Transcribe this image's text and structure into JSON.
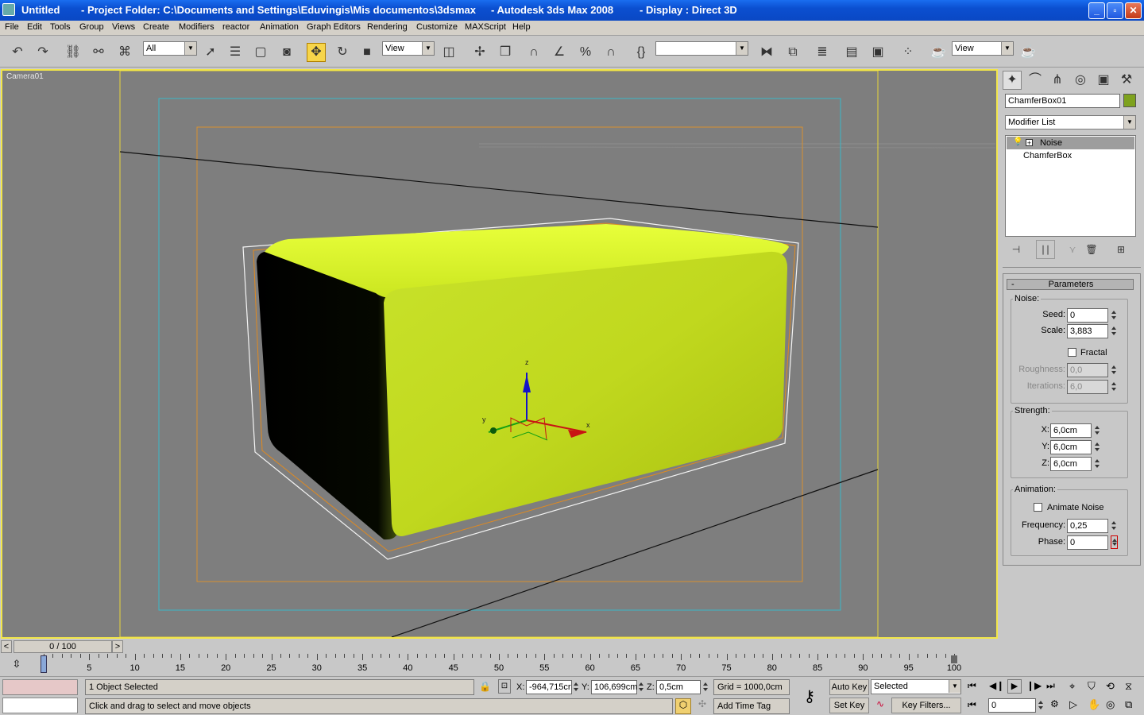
{
  "titlebar": {
    "file": "Untitled",
    "project": "- Project Folder: C:\\Documents and Settings\\Eduvingis\\Mis documentos\\3dsmax",
    "app": "- Autodesk 3ds Max 2008",
    "display": "- Display : Direct 3D",
    "min": "_",
    "max": "▫",
    "close": "✕"
  },
  "menus": [
    "File",
    "Edit",
    "Tools",
    "Group",
    "Views",
    "Create",
    "Modifiers",
    "reactor",
    "Animation",
    "Graph Editors",
    "Rendering",
    "Customize",
    "MAXScript",
    "Help"
  ],
  "toolbar": {
    "selection_filter": "All",
    "ref_coord": "View",
    "named_sel": "",
    "ref_coord2": "View"
  },
  "viewport": {
    "label": "Camera01",
    "colors": {
      "box": "#d8f22a",
      "border": "#f2e64a"
    }
  },
  "cmdpanel": {
    "object_name": "ChamferBox01",
    "object_color": "#7ea21e",
    "modifier_list": "Modifier List",
    "stack": [
      "Noise",
      "ChamferBox"
    ],
    "rollout_title": "Parameters",
    "rollout_minus": "-",
    "noise_group": "Noise:",
    "seed_label": "Seed:",
    "seed": "0",
    "scale_label": "Scale:",
    "scale": "3,883",
    "fractal_label": "Fractal",
    "roughness_label": "Roughness:",
    "roughness": "0,0",
    "iterations_label": "Iterations:",
    "iterations": "6,0",
    "strength_group": "Strength:",
    "x_label": "X:",
    "x": "6,0cm",
    "y_label": "Y:",
    "y": "6,0cm",
    "z_label": "Z:",
    "z": "6,0cm",
    "anim_group": "Animation:",
    "animate_label": "Animate Noise",
    "freq_label": "Frequency:",
    "freq": "0,25",
    "phase_label": "Phase:",
    "phase": "0"
  },
  "timeslider": {
    "frame": "0 / 100",
    "left": "<",
    "right": ">"
  },
  "track": {
    "ticks": [
      "5",
      "10",
      "15",
      "20",
      "25",
      "30",
      "35",
      "40",
      "45",
      "50",
      "55",
      "60",
      "65",
      "70",
      "75",
      "80",
      "85",
      "90",
      "95",
      "100"
    ]
  },
  "status": {
    "selected": "1 Object Selected",
    "prompt": "Click and drag to select and move objects",
    "x_label": "X:",
    "x": "-964,715cr",
    "y_label": "Y:",
    "y": "106,699cm",
    "z_label": "Z:",
    "z": "0,5cm",
    "grid": "Grid = 1000,0cm",
    "add_time_tag": "Add Time Tag",
    "auto_key": "Auto Key",
    "set_key": "Set Key",
    "selected_combo": "Selected",
    "key_filters": "Key Filters...",
    "current_frame": "0"
  }
}
